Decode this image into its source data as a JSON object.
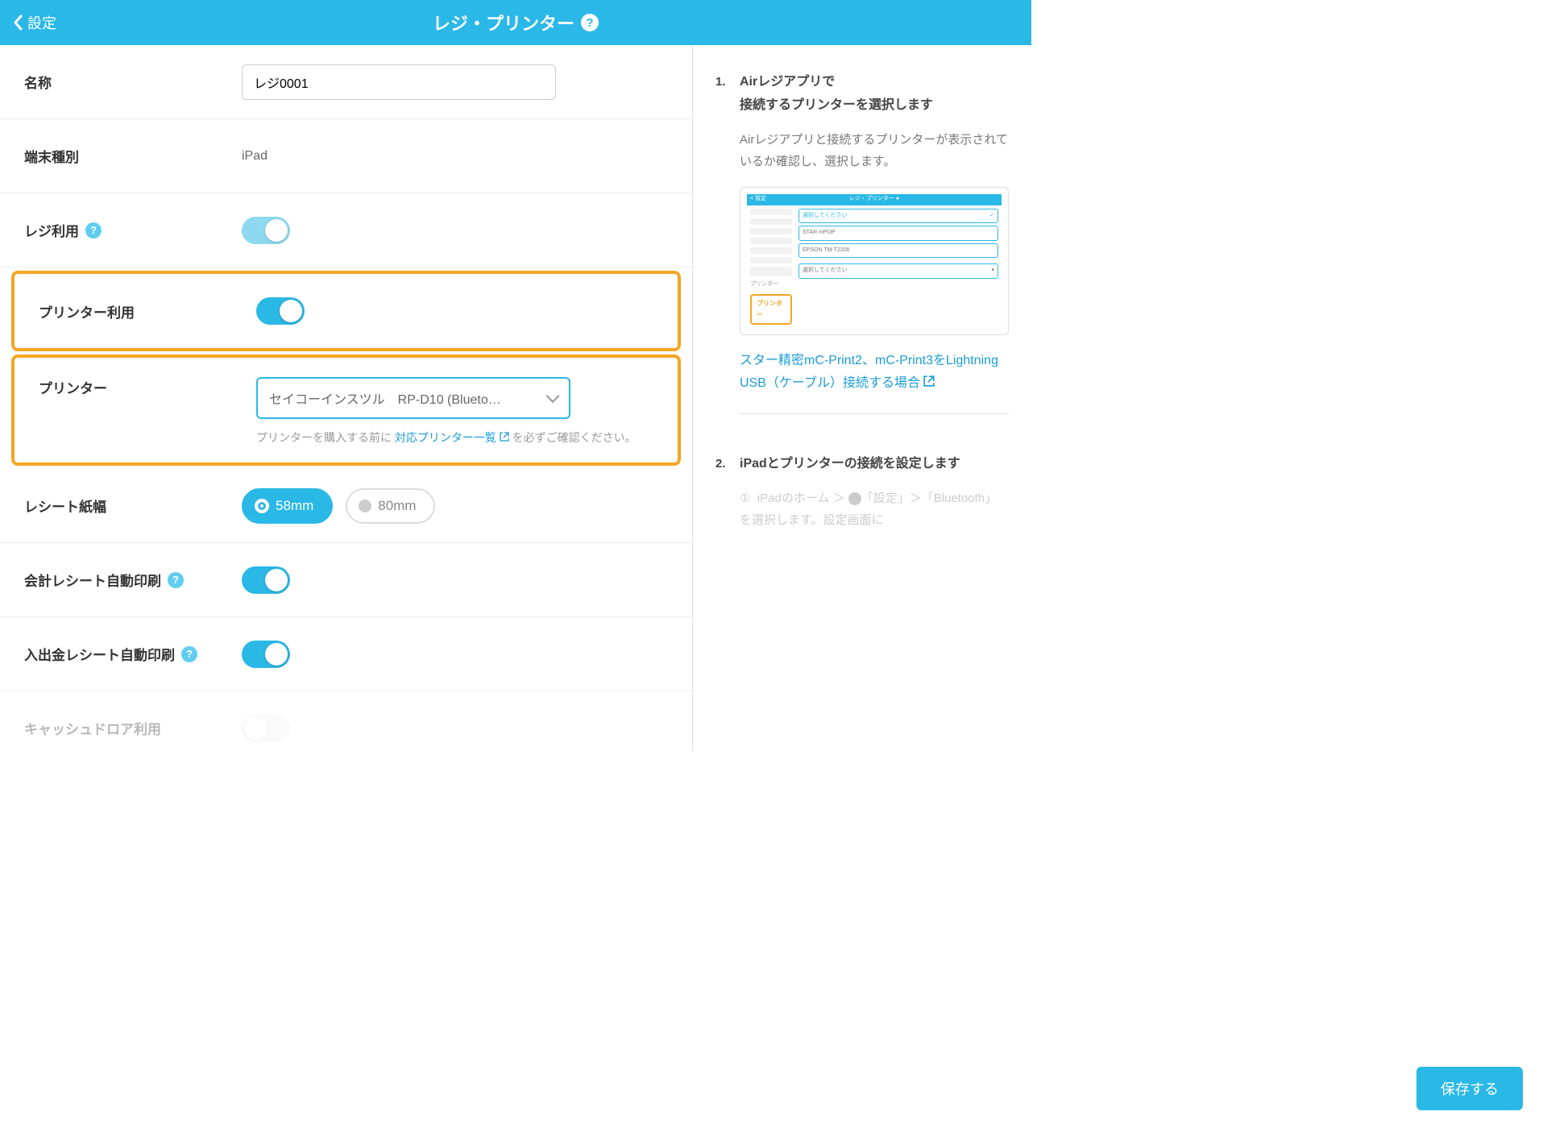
{
  "header": {
    "back_label": "設定",
    "title": "レジ・プリンター"
  },
  "form": {
    "name": {
      "label": "名称",
      "value": "レジ0001"
    },
    "device_type": {
      "label": "端末種別",
      "value": "iPad"
    },
    "register_use": {
      "label": "レジ利用",
      "on": true
    },
    "printer_use": {
      "label": "プリンター利用",
      "on": true
    },
    "printer": {
      "label": "プリンター",
      "value": "セイコーインスツル　RP-D10 (Blueto…",
      "hint_pre": "プリンターを購入する前に ",
      "hint_link": "対応プリンター一覧",
      "hint_post": " を必ずご確認ください。"
    },
    "paper_width": {
      "label": "レシート紙幅",
      "options": [
        "58mm",
        "80mm"
      ],
      "selected": "58mm"
    },
    "auto_receipt": {
      "label": "会計レシート自動印刷",
      "on": true
    },
    "auto_cash_receipt": {
      "label": "入出金レシート自動印刷",
      "on": true
    },
    "drawer_use": {
      "label": "キャッシュドロア利用",
      "on": false
    }
  },
  "side": {
    "step1_num": "1.",
    "step1_title": "Airレジアプリで\n接続するプリンターを選択します",
    "step1_text": "Airレジアプリと接続するプリンターが表示されているか確認し、選択します。",
    "mini": {
      "back": "< 設定",
      "title": "レジ・プリンター ●",
      "opt_placeholder": "選択してください",
      "opt1": "STAR mPOP",
      "opt2": "EPSON TM-T220II",
      "callout": "プリンター"
    },
    "link": "スター精密mC-Print2、mC-Print3をLightning USB（ケーブル）接続する場合",
    "step2_num": "2.",
    "step2_title": "iPadとプリンターの接続を設定します",
    "ghost_num": "①",
    "ghost_text": "iPadのホーム ＞ 　「設定」＞「Bluetooth」を選択します。設定画面に"
  },
  "footer": {
    "save_label": "保存する"
  }
}
